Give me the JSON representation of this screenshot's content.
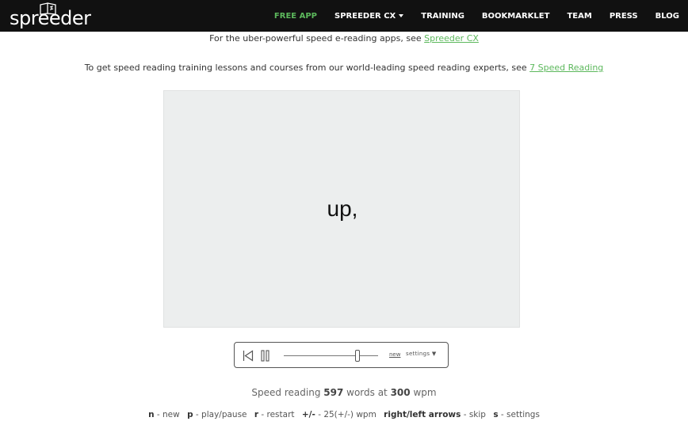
{
  "brand": {
    "name": "spreeder"
  },
  "nav": {
    "items": [
      {
        "label": "FREE APP"
      },
      {
        "label": "SPREEDER CX"
      },
      {
        "label": "TRAINING"
      },
      {
        "label": "BOOKMARKLET"
      },
      {
        "label": "TEAM"
      },
      {
        "label": "PRESS"
      },
      {
        "label": "BLOG"
      }
    ]
  },
  "colors": {
    "accent": "#5cb85c",
    "navbar": "#111111",
    "reader_bg": "#eceeee"
  },
  "info": {
    "line1_text": "For the uber-powerful speed e-reading apps, see ",
    "line1_link": "Spreeder CX",
    "line2_text": "To get speed reading training lessons and courses from our world-leading speed reading experts, see ",
    "line2_link": "7 Speed Reading"
  },
  "reader": {
    "current_word": "up,"
  },
  "controls": {
    "restart_icon": "skip-to-start-icon",
    "pause_icon": "pause-icon",
    "new_label": "new",
    "settings_label": "settings ▼"
  },
  "stats": {
    "prefix": "Speed reading ",
    "words": "597",
    "middle": " words at ",
    "wpm": "300",
    "suffix": " wpm"
  },
  "shortcuts": [
    {
      "key": "n",
      "desc": " - new"
    },
    {
      "key": "p",
      "desc": " - play/pause"
    },
    {
      "key": "r",
      "desc": " - restart"
    },
    {
      "key": "+/-",
      "desc": " - 25(+/-) wpm"
    },
    {
      "key": "right/left arrows",
      "desc": " - skip"
    },
    {
      "key": "s",
      "desc": " - settings"
    }
  ]
}
